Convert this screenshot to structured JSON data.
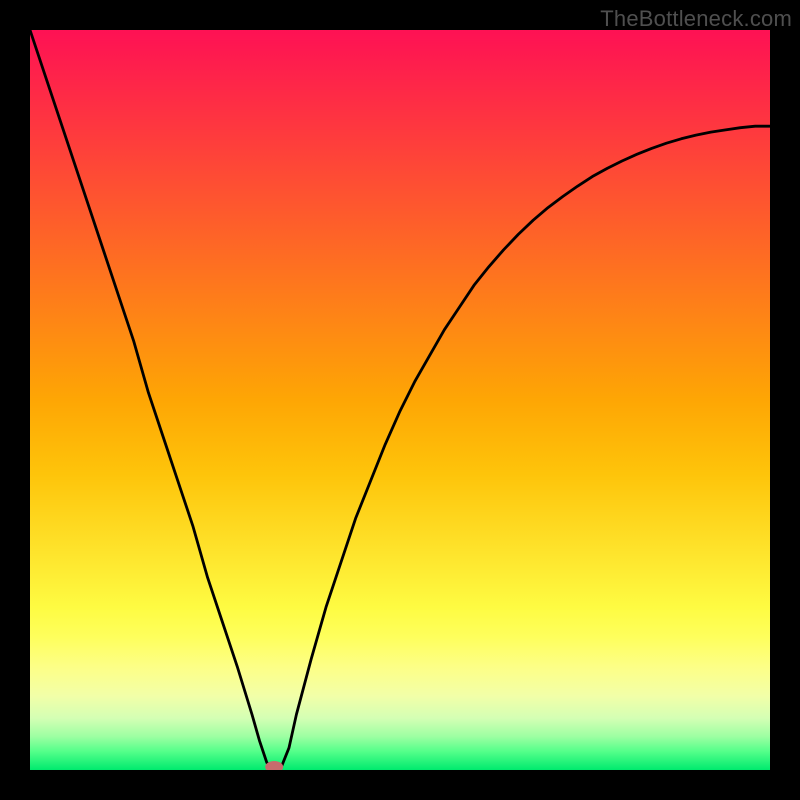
{
  "watermark": "TheBottleneck.com",
  "chart_data": {
    "type": "line",
    "title": "",
    "xlabel": "",
    "ylabel": "",
    "xlim": [
      0,
      100
    ],
    "ylim": [
      0,
      100
    ],
    "grid": false,
    "legend": false,
    "series": [
      {
        "name": "curve",
        "x": [
          0,
          2,
          4,
          6,
          8,
          10,
          12,
          14,
          16,
          18,
          20,
          22,
          24,
          26,
          28,
          30,
          31,
          32,
          33,
          34,
          35,
          36,
          38,
          40,
          42,
          44,
          46,
          48,
          50,
          52,
          54,
          56,
          58,
          60,
          62,
          64,
          66,
          68,
          70,
          72,
          74,
          76,
          78,
          80,
          82,
          84,
          86,
          88,
          90,
          92,
          94,
          96,
          98,
          100
        ],
        "y": [
          100,
          94,
          88,
          82,
          76,
          70,
          64,
          58,
          51,
          45,
          39,
          33,
          26,
          20,
          14,
          7.5,
          4,
          1,
          0,
          0.5,
          3,
          7.5,
          15,
          22,
          28,
          34,
          39,
          44,
          48.5,
          52.5,
          56,
          59.5,
          62.5,
          65.5,
          68,
          70.3,
          72.4,
          74.3,
          76,
          77.5,
          78.9,
          80.2,
          81.3,
          82.3,
          83.2,
          84,
          84.7,
          85.3,
          85.8,
          86.2,
          86.5,
          86.8,
          87,
          87
        ]
      }
    ],
    "marker": {
      "x": 33,
      "y": 0,
      "color": "#c76b6d"
    },
    "background_gradient": {
      "stops": [
        {
          "offset": 0.0,
          "color": "#fe1154"
        },
        {
          "offset": 0.1,
          "color": "#fe2e44"
        },
        {
          "offset": 0.2,
          "color": "#fe4c34"
        },
        {
          "offset": 0.3,
          "color": "#fe6a24"
        },
        {
          "offset": 0.4,
          "color": "#fe8814"
        },
        {
          "offset": 0.5,
          "color": "#fea604"
        },
        {
          "offset": 0.6,
          "color": "#fec40a"
        },
        {
          "offset": 0.7,
          "color": "#fee22a"
        },
        {
          "offset": 0.78,
          "color": "#fefb42"
        },
        {
          "offset": 0.82,
          "color": "#feff5c"
        },
        {
          "offset": 0.86,
          "color": "#fdff86"
        },
        {
          "offset": 0.9,
          "color": "#f2ffa8"
        },
        {
          "offset": 0.93,
          "color": "#d4ffb4"
        },
        {
          "offset": 0.955,
          "color": "#9cffa2"
        },
        {
          "offset": 0.975,
          "color": "#54ff8a"
        },
        {
          "offset": 1.0,
          "color": "#00ea6e"
        }
      ]
    }
  }
}
